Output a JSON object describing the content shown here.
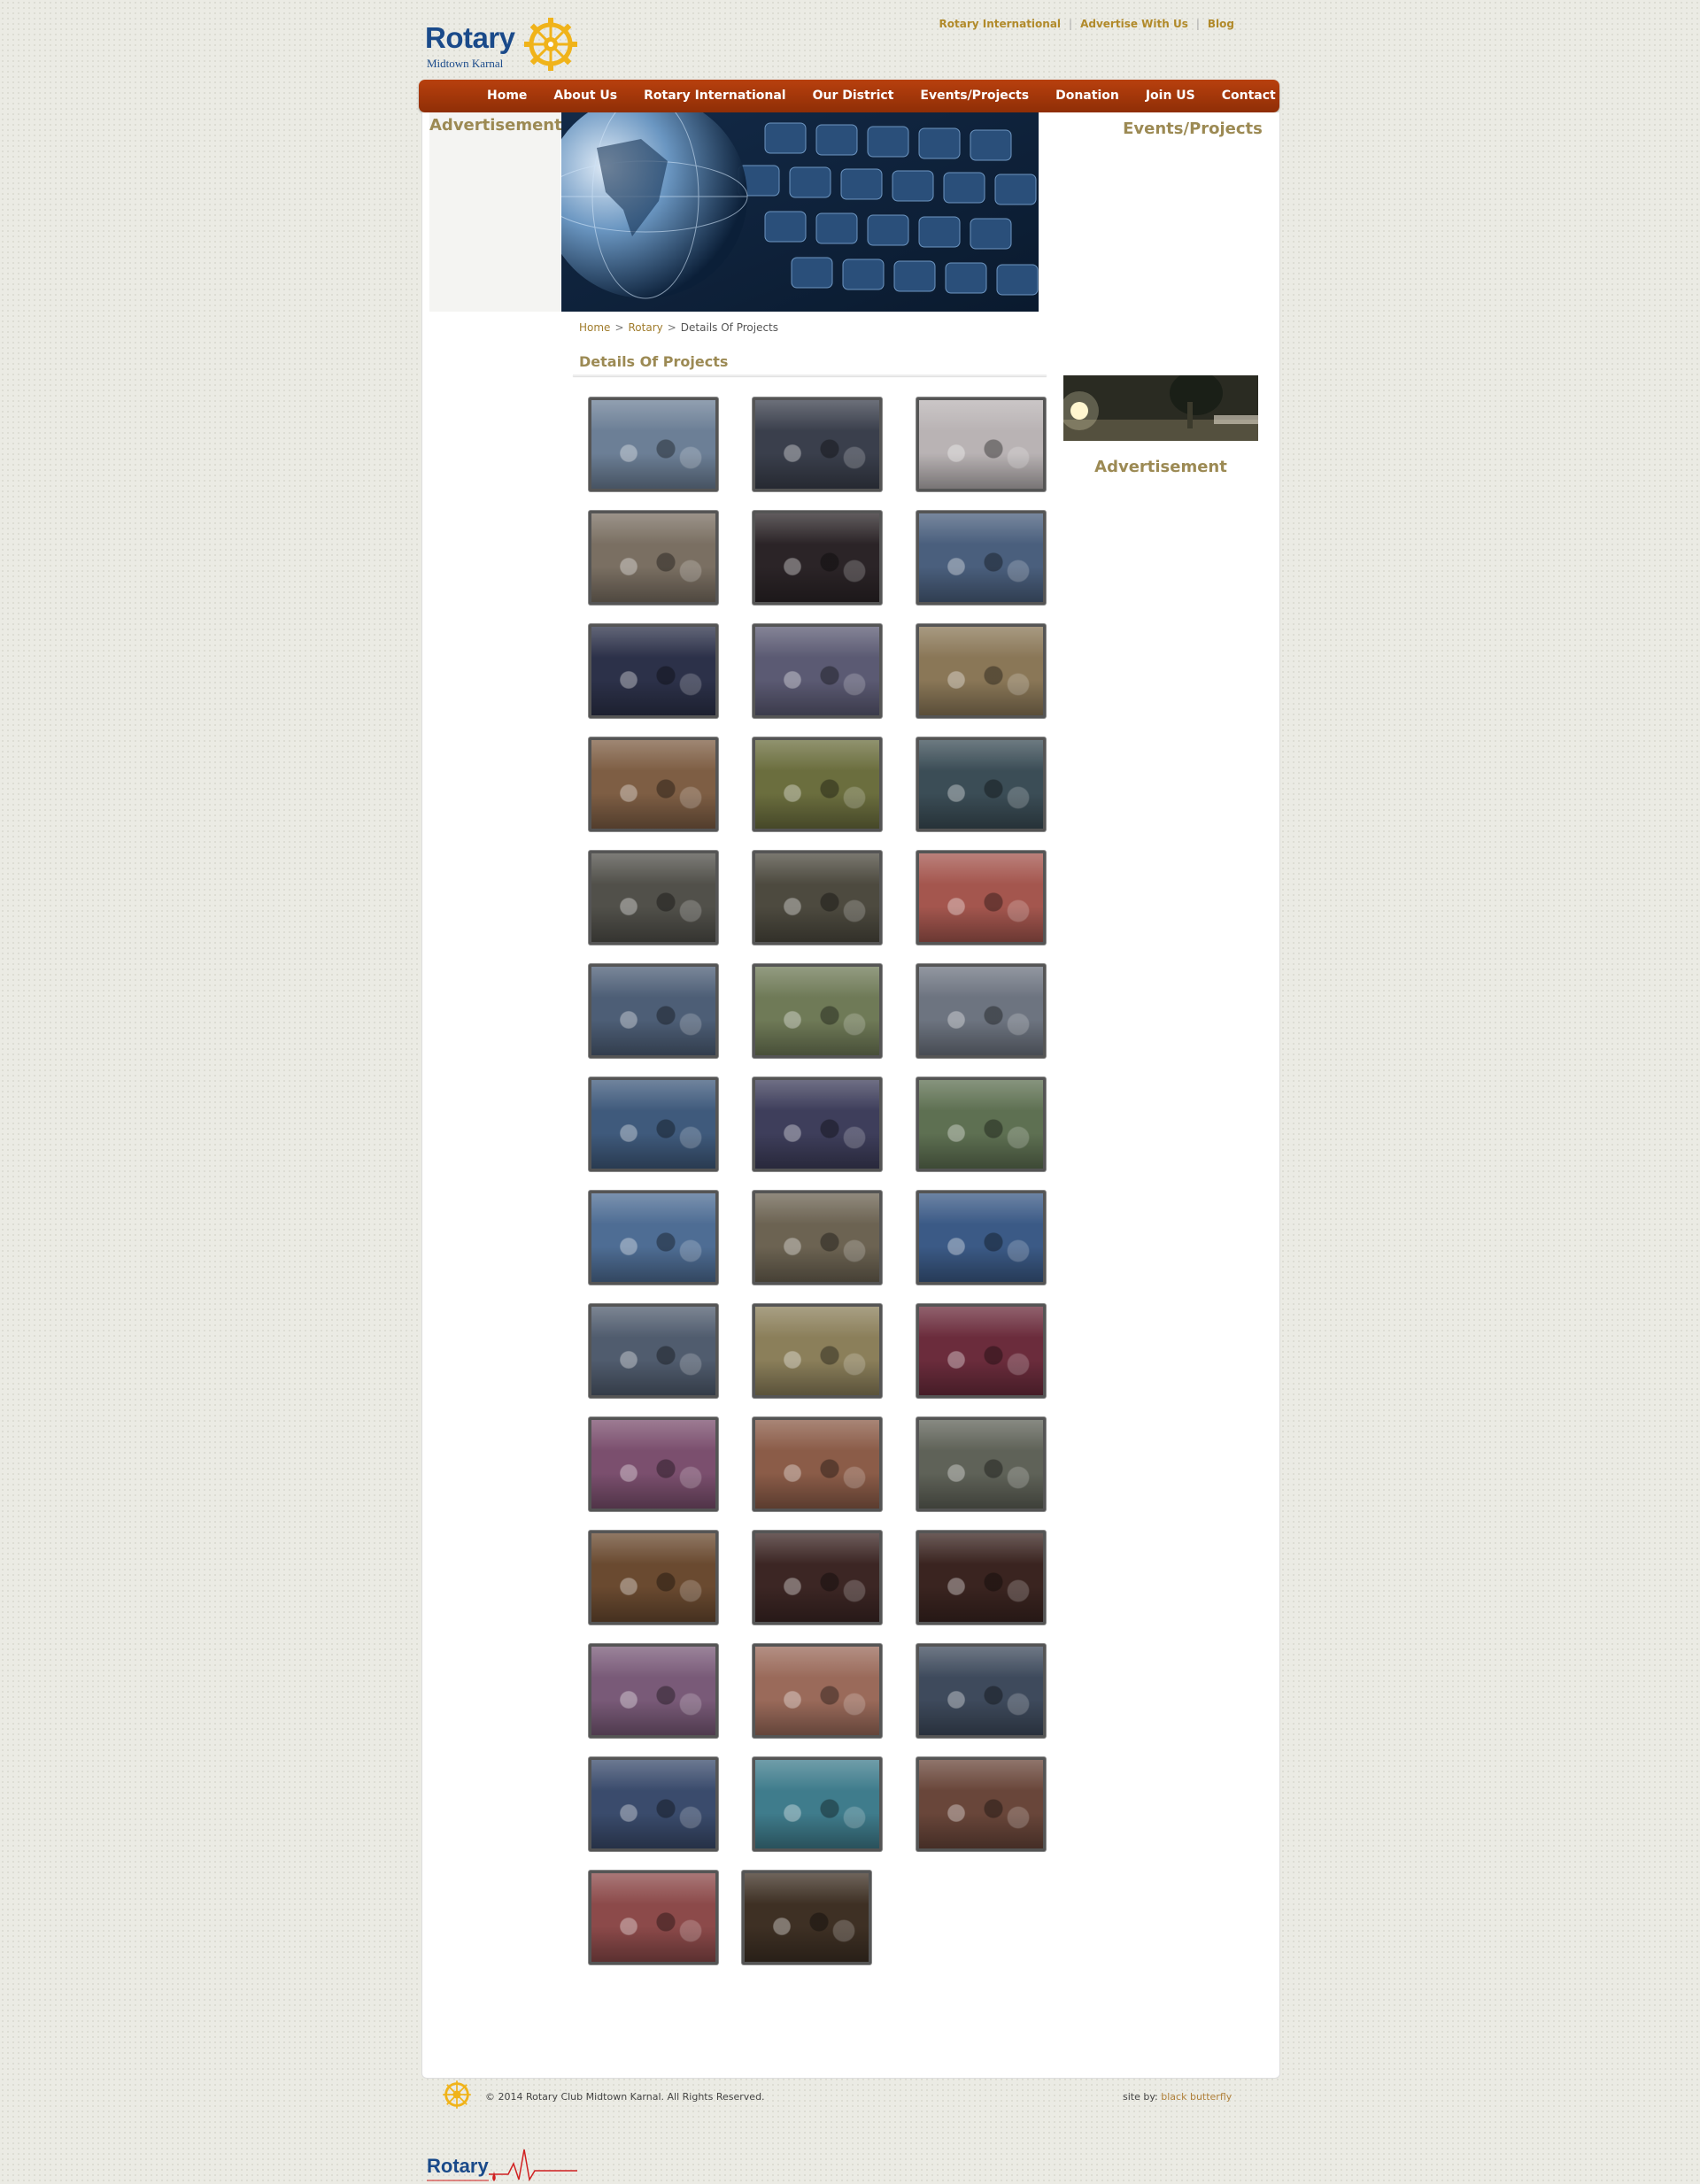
{
  "header": {
    "logo_word": "Rotary",
    "logo_sub": "Midtown Karnal",
    "top_links": [
      "Rotary International",
      "Advertise With Us",
      "Blog"
    ]
  },
  "nav": [
    "Home",
    "About Us",
    "Rotary International",
    "Our District",
    "Events/Projects",
    "Donation",
    "Join US",
    "Contact"
  ],
  "left_ad_title": "Advertisement",
  "right": {
    "events_title": "Events/Projects",
    "ad_title": "Advertisement"
  },
  "breadcrumb": {
    "home": "Home",
    "rotary": "Rotary",
    "current": "Details Of Projects",
    "sep": ">"
  },
  "section_title": "Details Of Projects",
  "gallery_colors": [
    [
      "#6c7f96",
      "#3a3f4c",
      "#b9b3b4"
    ],
    [
      "#7a6f62",
      "#2b2427",
      "#4a5f7d"
    ],
    [
      "#2c3149",
      "#5b5a73",
      "#8a7757"
    ],
    [
      "#7e5e44",
      "#6b6e3e",
      "#3b4d56"
    ],
    [
      "#51504a",
      "#4d4a3f",
      "#a4564e"
    ],
    [
      "#4d5e76",
      "#6f7a57",
      "#6d7480"
    ],
    [
      "#3f5a7c",
      "#3e3e5b",
      "#5e7052"
    ],
    [
      "#4e6d94",
      "#6c6352",
      "#3b5a86"
    ],
    [
      "#505c6e",
      "#8b7f5a",
      "#6b2c3c"
    ],
    [
      "#7b4f6e",
      "#8b5c48",
      "#5f6258"
    ],
    [
      "#6a4a30",
      "#3c2624",
      "#3a2420"
    ],
    [
      "#795a78",
      "#9a6a5a",
      "#3e4a5c"
    ],
    [
      "#3a4b6c",
      "#3f7c8c",
      "#69463a"
    ],
    [
      "#8c4a4a",
      "#3e3024"
    ]
  ],
  "footer": {
    "logo_word": "Rotary",
    "copyright": "© 2014 Rotary Club Midtown Karnal. All Rights Reserved.",
    "credit_prefix": "site by:",
    "credit_link": "black butterfly"
  }
}
